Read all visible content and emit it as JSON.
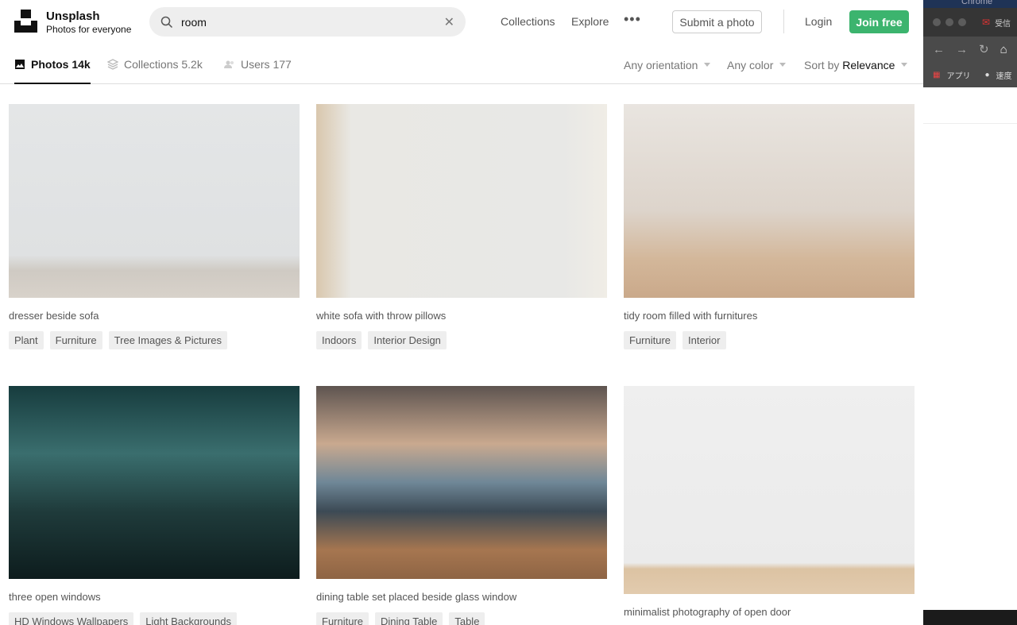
{
  "header": {
    "brand": "Unsplash",
    "tagline": "Photos for everyone",
    "search_value": "room",
    "nav": [
      "Collections",
      "Explore"
    ],
    "submit": "Submit a photo",
    "login": "Login",
    "join": "Join free",
    "accent": "#3cb46e"
  },
  "tabs": [
    {
      "label": "Photos 14k",
      "active": true
    },
    {
      "label": "Collections 5.2k"
    },
    {
      "label": "Users 177"
    }
  ],
  "filters": {
    "orientation": "Any orientation",
    "color": "Any color",
    "sort_prefix": "Sort by",
    "sort_value": "Relevance"
  },
  "photos": [
    {
      "caption": "dresser beside sofa",
      "tags": [
        "Plant",
        "Furniture",
        "Tree Images & Pictures"
      ]
    },
    {
      "caption": "white sofa with throw pillows",
      "tags": [
        "Indoors",
        "Interior Design"
      ]
    },
    {
      "caption": "tidy room filled with furnitures",
      "tags": [
        "Furniture",
        "Interior"
      ]
    },
    {
      "caption": "three open windows",
      "tags": [
        "HD Windows Wallpapers",
        "Light Backgrounds"
      ]
    },
    {
      "caption": "dining table set placed beside glass window",
      "tags": [
        "Furniture",
        "Dining Table",
        "Table"
      ]
    },
    {
      "caption": "minimalist photography of open door",
      "tags": []
    }
  ],
  "chrome_overlay": {
    "title": "Chrome",
    "tab_label": "受信",
    "apps": "アプリ",
    "bookmark": "速度"
  }
}
